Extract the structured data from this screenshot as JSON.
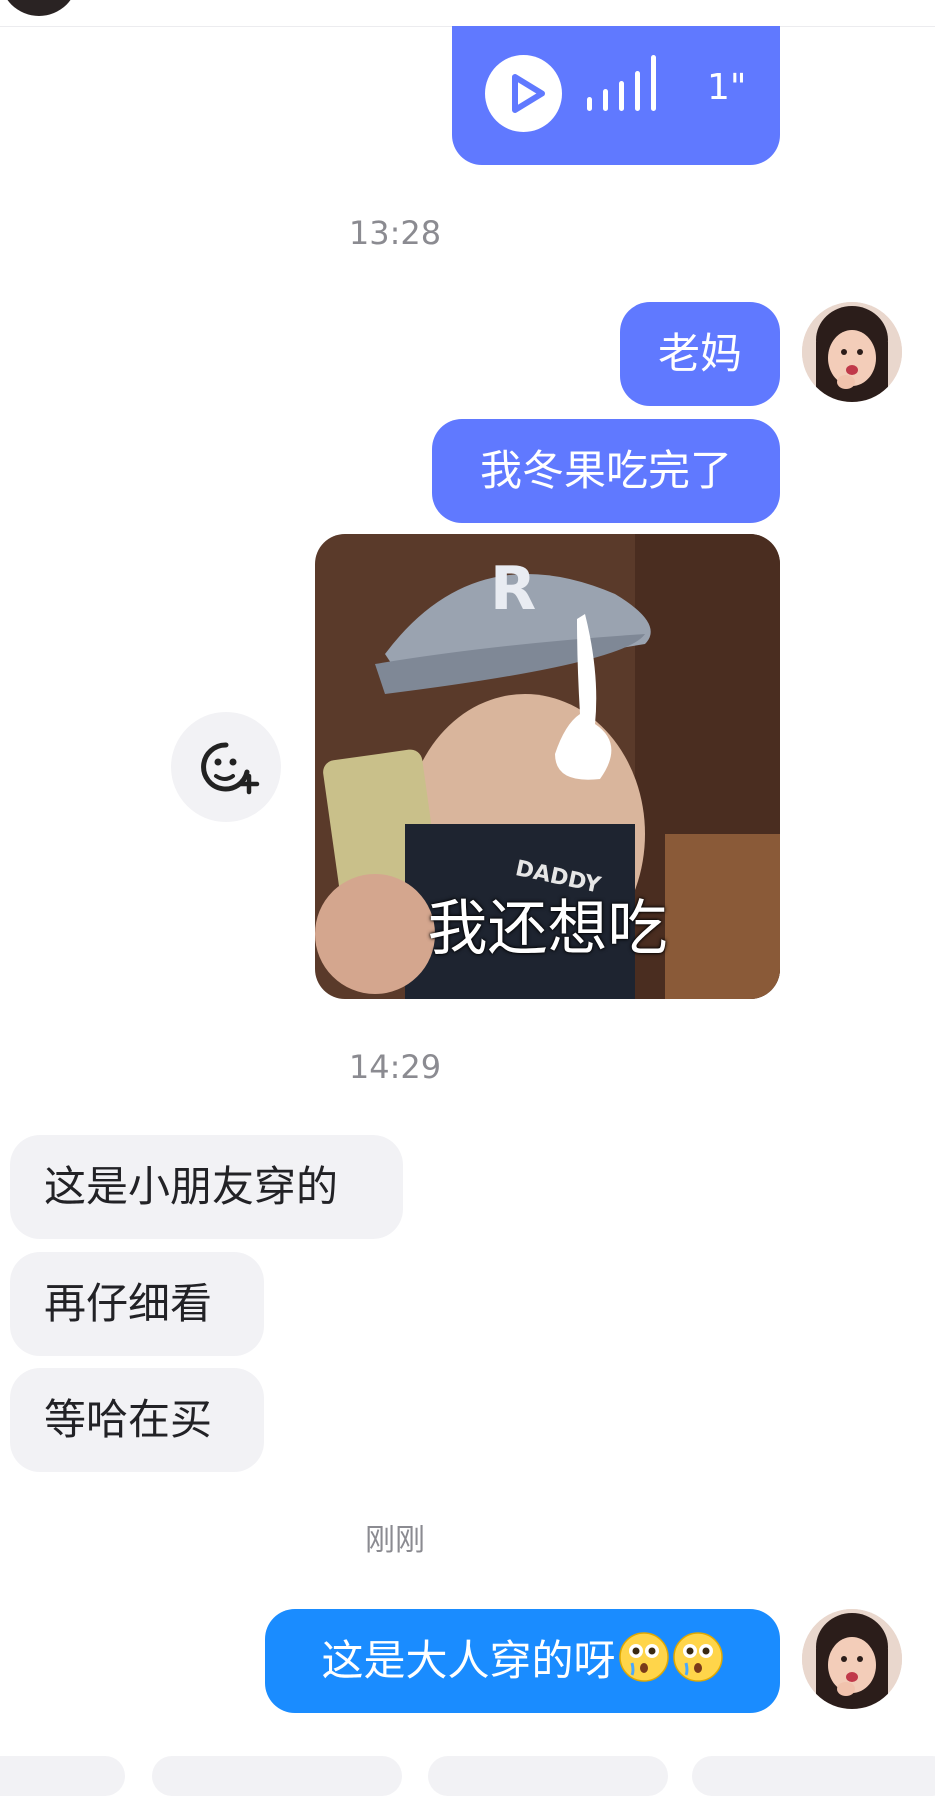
{
  "conversation": {
    "voice_message": {
      "duration": "1\""
    },
    "timestamps": {
      "first": "13:28",
      "second": "14:29",
      "third": "刚刚"
    },
    "outgoing": {
      "msg1": "老妈",
      "msg2": "我冬果吃完了",
      "sticker_caption": "我还想吃",
      "msg_last": "这是大人穿的呀"
    },
    "incoming": {
      "msg1": "这是小朋友穿的",
      "msg2": "再仔细看",
      "msg3": "等哈在买"
    }
  },
  "icons": {
    "play": "play-icon",
    "voice_wave": "voice-wave-icon",
    "add_sticker": "add-emoji-icon",
    "emoji": "flushed-face-emoji"
  },
  "colors": {
    "outgoing_bubble": "#6079ff",
    "outgoing_bubble_latest": "#1a8cff",
    "incoming_bubble": "#f2f2f5",
    "timestamp_text": "#8b8b91"
  }
}
